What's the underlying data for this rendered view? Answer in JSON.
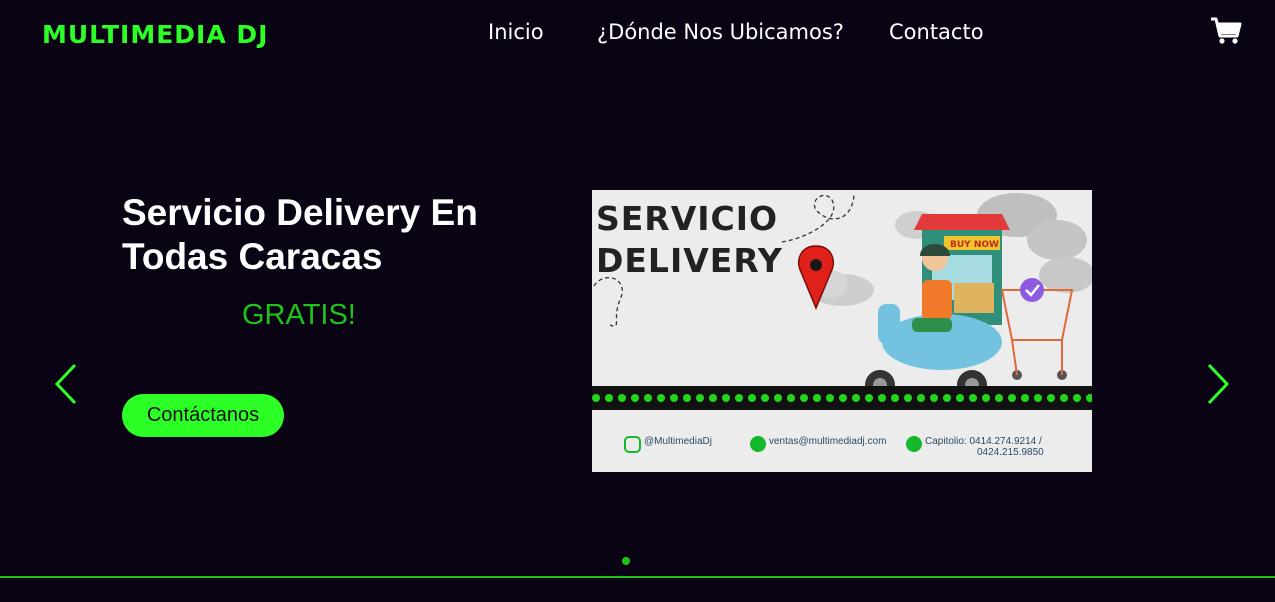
{
  "brand": "MULTIMEDIA DJ",
  "nav": {
    "items": [
      {
        "label": "Inicio"
      },
      {
        "label": "¿Dónde Nos Ubicamos?"
      },
      {
        "label": "Contacto"
      }
    ],
    "cart_icon": "shopping-cart-icon"
  },
  "hero": {
    "title": "Servicio Delivery En Todas Caracas",
    "subtitle": "GRATIS!",
    "cta_label": "Contáctanos"
  },
  "banner": {
    "title_line1": "SERVICIO",
    "title_line2": "DELIVERY",
    "sign": "BUY NOW",
    "instagram": "@MultimediaDj",
    "email": "ventas@multimediadj.com",
    "phone_line1": "Capitolio: 0414.274.9214 /",
    "phone_line2": "0424.215.9850"
  },
  "carousel": {
    "prev_icon": "chevron-left-icon",
    "next_icon": "chevron-right-icon",
    "slide_count": 1,
    "active_slide": 1
  },
  "colors": {
    "background": "#0a0314",
    "accent": "#2cff26",
    "accent_dark": "#1fc21a"
  }
}
